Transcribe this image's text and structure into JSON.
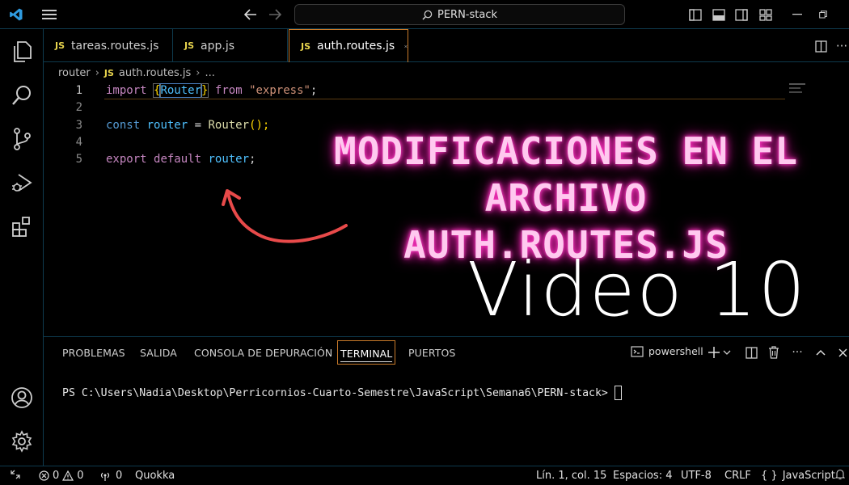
{
  "titlebar": {
    "search_text": "PERN-stack"
  },
  "tabs": [
    {
      "badge": "JS",
      "label": "tareas.routes.js"
    },
    {
      "badge": "JS",
      "label": "app.js"
    },
    {
      "badge": "JS",
      "label": "auth.routes.js",
      "active": true
    }
  ],
  "breadcrumb": {
    "folder": "router",
    "badge": "JS",
    "file": "auth.routes.js",
    "more": "..."
  },
  "editor": {
    "line_numbers": [
      "1",
      "2",
      "3",
      "4",
      "5"
    ],
    "lines": {
      "l1": {
        "kw1": "import",
        "b1": "{",
        "id": "Router",
        "b2": "}",
        "kw2": "from",
        "str": "\"express\"",
        "semi": ";"
      },
      "l3": {
        "kw": "const",
        "id": "router",
        "eq": " = ",
        "fn": "Router",
        "rest": "();"
      },
      "l5": {
        "kw1": "export",
        "kw2": "default",
        "id": "router",
        "semi": ";"
      }
    }
  },
  "overlay": {
    "neon_line1": "MODIFICACIONES EN EL ARCHIVO",
    "neon_line2": "AUTH.ROUTES.JS",
    "video_title": "Video 10"
  },
  "panel": {
    "tabs": [
      "PROBLEMAS",
      "SALIDA",
      "CONSOLA DE DEPURACIÓN",
      "TERMINAL",
      "PUERTOS"
    ],
    "active_tab": "TERMINAL",
    "shell": "powershell",
    "prompt": "PS C:\\Users\\Nadia\\Desktop\\Perricornios-Cuarto-Semestre\\JavaScript\\Semana6\\PERN-stack>"
  },
  "status": {
    "errors": "0",
    "warnings": "0",
    "ports": "0",
    "extension": "Quokka",
    "position": "Lín. 1, col. 15",
    "spaces": "Espacios: 4",
    "encoding": "UTF-8",
    "eol": "CRLF",
    "language_icon": "{ }",
    "language": "JavaScript"
  },
  "colors": {
    "accent_border": "#0e3a4e",
    "active_tab_border": "#c87a2a",
    "neon": "#ff2fbf",
    "arrow": "#e84a4a"
  }
}
